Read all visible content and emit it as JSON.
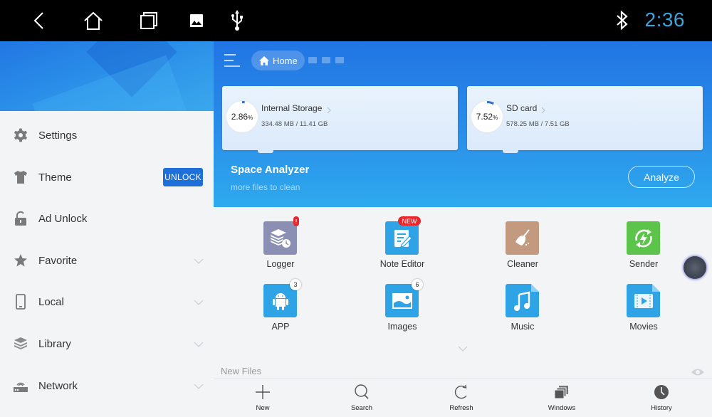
{
  "status_bar": {
    "nav_icons": [
      "back-icon",
      "home-icon",
      "recents-icon",
      "gallery-icon",
      "usb-icon"
    ],
    "bluetooth_icon": "bluetooth-icon",
    "time": "2:36",
    "time_color": "#3ea3dc"
  },
  "sidebar": {
    "items": [
      {
        "label": "Settings",
        "icon": "gear-icon",
        "expandable": false
      },
      {
        "label": "Theme",
        "icon": "tshirt-icon",
        "expandable": false,
        "action": "UNLOCK"
      },
      {
        "label": "Ad Unlock",
        "icon": "unlock-icon",
        "expandable": false
      },
      {
        "label": "Favorite",
        "icon": "star-icon",
        "expandable": true
      },
      {
        "label": "Local",
        "icon": "phone-icon",
        "expandable": true
      },
      {
        "label": "Library",
        "icon": "layers-icon",
        "expandable": true
      },
      {
        "label": "Network",
        "icon": "router-icon",
        "expandable": true
      }
    ]
  },
  "header": {
    "breadcrumb": {
      "label": "Home",
      "icon": "home-icon"
    }
  },
  "storage": [
    {
      "name": "Internal Storage",
      "percent_value": "2.86",
      "percent_unit": "%",
      "usage": "334.48 MB / 11.41 GB",
      "fraction": 0.0286
    },
    {
      "name": "SD card",
      "percent_value": "7.52",
      "percent_unit": "%",
      "usage": "578.25 MB / 7.51 GB",
      "fraction": 0.0752
    }
  ],
  "space_analyzer": {
    "title": "Space Analyzer",
    "subtitle": "more files to clean",
    "button": "Analyze"
  },
  "tools": [
    {
      "label": "Logger",
      "icon": "logger-icon",
      "color": "#8a8fb3",
      "badge": "!"
    },
    {
      "label": "Note Editor",
      "icon": "note-editor-icon",
      "color": "#2ea3e6",
      "badge": "NEW"
    },
    {
      "label": "Cleaner",
      "icon": "broom-icon",
      "color": "#c39a7f",
      "badge": ""
    },
    {
      "label": "Sender",
      "icon": "sender-icon",
      "color": "#5cc44b",
      "badge": ""
    },
    {
      "label": "APP",
      "icon": "android-icon",
      "color": "#2ea3e6",
      "badge": "3"
    },
    {
      "label": "Images",
      "icon": "image-icon",
      "color": "#2ea3e6",
      "badge": "6"
    },
    {
      "label": "Music",
      "icon": "music-icon",
      "color": "#2ea3e6",
      "badge": ""
    },
    {
      "label": "Movies",
      "icon": "movie-icon",
      "color": "#2ea3e6",
      "badge": ""
    }
  ],
  "new_files": {
    "label": "New Files"
  },
  "bottom_bar": [
    {
      "label": "New",
      "icon": "plus-icon"
    },
    {
      "label": "Search",
      "icon": "search-icon"
    },
    {
      "label": "Refresh",
      "icon": "refresh-icon"
    },
    {
      "label": "Windows",
      "icon": "windows-icon"
    },
    {
      "label": "History",
      "icon": "clock-icon"
    }
  ],
  "colors": {
    "accent": "#1f6fd9",
    "hero_top": "#2175e3",
    "hero_bottom": "#2eaaee",
    "badge_red": "#e8262b"
  }
}
